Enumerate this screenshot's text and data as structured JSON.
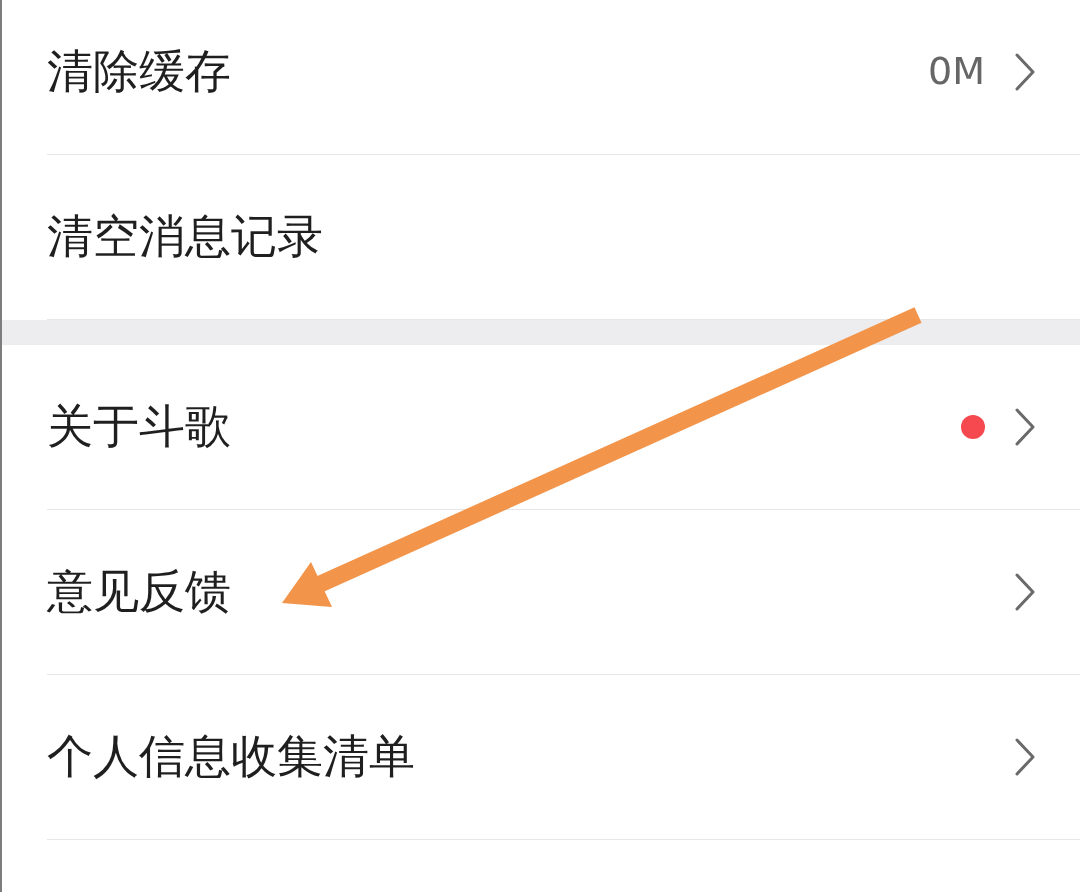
{
  "settings_groups": [
    {
      "rows": [
        {
          "label": "清除缓存",
          "value": "0M",
          "dot": false,
          "chevron": true,
          "annotation_arrow": false
        },
        {
          "label": "清空消息记录",
          "dot": false,
          "chevron": false,
          "annotation_arrow": false
        }
      ]
    },
    {
      "rows": [
        {
          "label": "关于斗歌",
          "dot": true,
          "chevron": true,
          "annotation_arrow": false
        },
        {
          "label": "意见反馈",
          "dot": false,
          "chevron": true,
          "annotation_arrow": true
        },
        {
          "label": "个人信息收集清单",
          "dot": false,
          "chevron": true,
          "annotation_arrow": false
        }
      ]
    }
  ]
}
